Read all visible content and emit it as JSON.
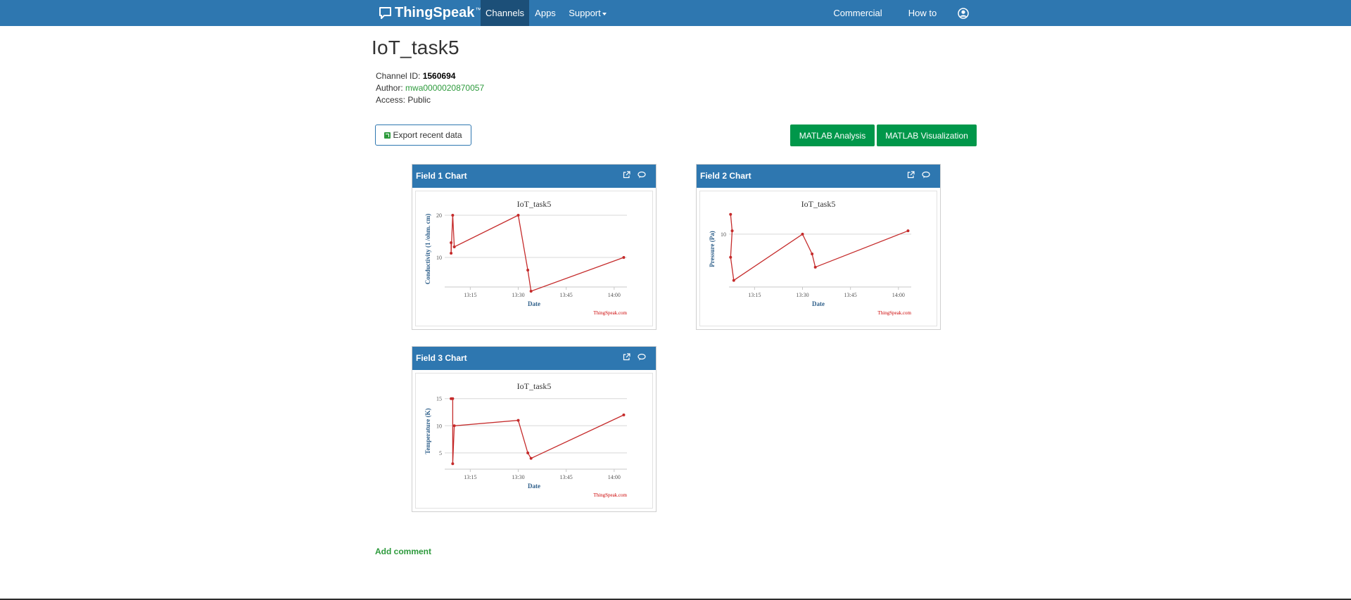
{
  "nav": {
    "brand": "ThingSpeak",
    "brand_tm": "™",
    "channels": "Channels",
    "apps": "Apps",
    "support": "Support",
    "commercial": "Commercial Use",
    "how_to_buy": "How to Buy",
    "colors": {
      "bar": "#2e77b0",
      "active": "#1c4f78"
    }
  },
  "channel": {
    "title": "IoT_task5",
    "id_label": "Channel ID: ",
    "id_value": "1560694",
    "author_label": "Author: ",
    "author_value": "mwa0000020870057",
    "access_label": "Access: ",
    "access_value": "Public"
  },
  "actions": {
    "export": "Export recent data",
    "matlab_analysis": "MATLAB Analysis",
    "matlab_visualization": "MATLAB Visualization"
  },
  "widgets": [
    {
      "title": "Field 1 Chart"
    },
    {
      "title": "Field 2 Chart"
    },
    {
      "title": "Field 3 Chart"
    }
  ],
  "chart_data": [
    {
      "type": "line",
      "title": "IoT_task5",
      "xlabel": "Date",
      "ylabel": "Conductivity (1 /ohm. cm)",
      "credit": "ThingSpeak.com",
      "xlim": [
        "13:07",
        "14:04"
      ],
      "x_ticks": [
        "13:15",
        "13:30",
        "13:45",
        "14:00"
      ],
      "ylim": [
        3,
        21
      ],
      "y_ticks": [
        10,
        20
      ],
      "series": [
        {
          "color": "#c52b2b",
          "x": [
            "13:09",
            "13:09",
            "13:09.5",
            "13:10",
            "13:30",
            "13:33",
            "13:34",
            "14:03"
          ],
          "y": [
            13.5,
            11,
            20,
            12.5,
            20,
            7,
            2,
            10
          ]
        }
      ]
    },
    {
      "type": "line",
      "title": "IoT_task5",
      "xlabel": "Date",
      "ylabel": "Pressure (Pa)",
      "credit": "ThingSpeak.com",
      "xlim": [
        "13:07",
        "14:04"
      ],
      "x_ticks": [
        "13:15",
        "13:30",
        "13:45",
        "14:00"
      ],
      "ylim": [
        2,
        13.5
      ],
      "y_ticks": [
        10
      ],
      "series": [
        {
          "color": "#c52b2b",
          "x": [
            "13:07.5",
            "13:08",
            "13:07.5",
            "13:08.5",
            "13:30",
            "13:33",
            "13:34",
            "14:03"
          ],
          "y": [
            13,
            10.5,
            6.5,
            3,
            10,
            7,
            5,
            10.5
          ]
        }
      ]
    },
    {
      "type": "line",
      "title": "IoT_task5",
      "xlabel": "Date",
      "ylabel": "Temperature (K)",
      "credit": "ThingSpeak.com",
      "xlim": [
        "13:07",
        "14:04"
      ],
      "x_ticks": [
        "13:15",
        "13:30",
        "13:45",
        "14:00"
      ],
      "ylim": [
        2,
        16
      ],
      "y_ticks": [
        5,
        10,
        15
      ],
      "series": [
        {
          "color": "#c52b2b",
          "x": [
            "13:09",
            "13:09.5",
            "13:09.5",
            "13:10",
            "13:30",
            "13:33",
            "13:34",
            "14:03"
          ],
          "y": [
            15,
            15,
            3,
            10,
            11,
            5,
            4,
            12
          ]
        }
      ]
    }
  ],
  "footer": {
    "add_comment": "Add comment"
  }
}
